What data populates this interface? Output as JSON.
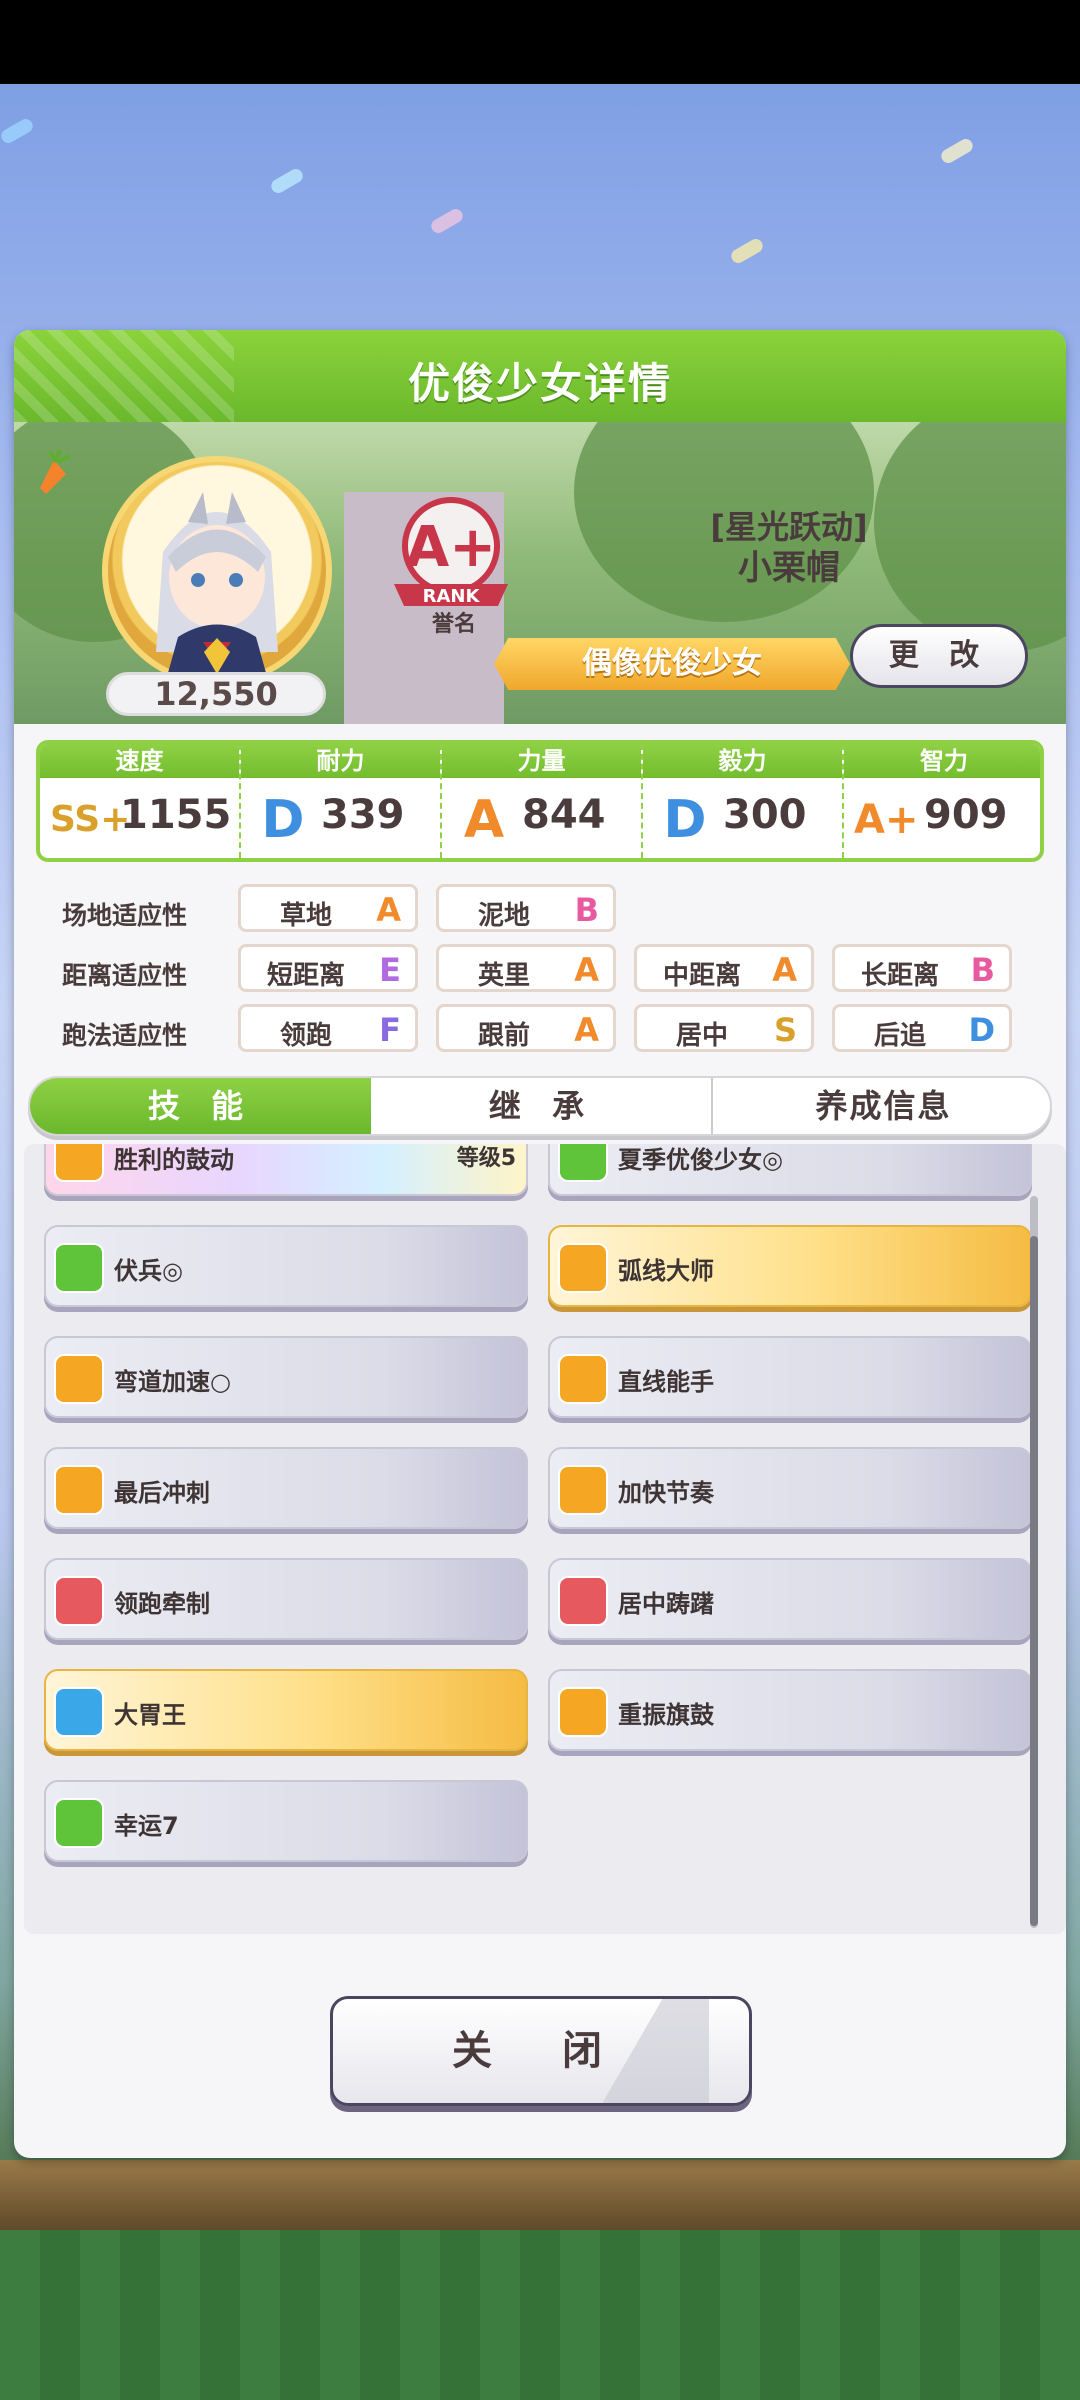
{
  "dialog": {
    "title": "优俊少女详情"
  },
  "profile": {
    "fans": "12,550",
    "rank_grade": "A+",
    "rank_word": "RANK",
    "rank_caption": "誉名",
    "epithet": "[星光跃动]",
    "name": "小栗帽",
    "style_ribbon": "偶像优俊少女",
    "change_label": "更 改"
  },
  "stats": [
    {
      "label": "速度",
      "grade": "SS+",
      "value": "1155",
      "icon": "shoe-icon",
      "color": "#d9a12b"
    },
    {
      "label": "耐力",
      "grade": "D",
      "value": "339",
      "icon": "heart-icon",
      "color": "#3f8fe0"
    },
    {
      "label": "力量",
      "grade": "A",
      "value": "844",
      "icon": "muscle-icon",
      "color": "#f08a2a"
    },
    {
      "label": "毅力",
      "grade": "D",
      "value": "300",
      "icon": "flame-icon",
      "color": "#3f8fe0"
    },
    {
      "label": "智力",
      "grade": "A+",
      "value": "909",
      "icon": "grad-cap-icon",
      "color": "#f08a2a"
    }
  ],
  "aptitudes": {
    "surface": {
      "label": "场地适应性",
      "items": [
        {
          "name": "草地",
          "grade": "A",
          "color": "#f08a2a"
        },
        {
          "name": "泥地",
          "grade": "B",
          "color": "#e85aa0"
        }
      ]
    },
    "distance": {
      "label": "距离适应性",
      "items": [
        {
          "name": "短距离",
          "grade": "E",
          "color": "#b26ae0"
        },
        {
          "name": "英里",
          "grade": "A",
          "color": "#f08a2a"
        },
        {
          "name": "中距离",
          "grade": "A",
          "color": "#f08a2a"
        },
        {
          "name": "长距离",
          "grade": "B",
          "color": "#e85aa0"
        }
      ]
    },
    "style": {
      "label": "跑法适应性",
      "items": [
        {
          "name": "领跑",
          "grade": "F",
          "color": "#8a6ae0"
        },
        {
          "name": "跟前",
          "grade": "A",
          "color": "#f08a2a"
        },
        {
          "name": "居中",
          "grade": "S",
          "color": "#d9a12b"
        },
        {
          "name": "后追",
          "grade": "D",
          "color": "#3f8fe0"
        }
      ]
    }
  },
  "tabs": [
    {
      "label": "技 能"
    },
    {
      "label": "继 承"
    },
    {
      "label": "养成信息"
    }
  ],
  "skills": [
    {
      "name": "胜利的鼓动",
      "level": "等级5",
      "style": "rainbow",
      "icon": "lion-icon",
      "icon_color": "#f5a623"
    },
    {
      "name": "夏季优俊少女◎",
      "level": "",
      "style": "plain",
      "icon": "book-icon",
      "icon_color": "#5fc43a"
    },
    {
      "name": "伏兵◎",
      "level": "",
      "style": "plain",
      "icon": "book-icon",
      "icon_color": "#5fc43a"
    },
    {
      "name": "弧线大师",
      "level": "",
      "style": "gold",
      "icon": "lion-icon",
      "icon_color": "#f5a623"
    },
    {
      "name": "弯道加速○",
      "level": "",
      "style": "plain",
      "icon": "lion-icon",
      "icon_color": "#f5a623"
    },
    {
      "name": "直线能手",
      "level": "",
      "style": "plain",
      "icon": "lion-icon",
      "icon_color": "#f5a623"
    },
    {
      "name": "最后冲刺",
      "level": "",
      "style": "plain",
      "icon": "lion-icon",
      "icon_color": "#f5a623"
    },
    {
      "name": "加快节奏",
      "level": "",
      "style": "plain",
      "icon": "lion-icon",
      "icon_color": "#f5a623"
    },
    {
      "name": "领跑牵制",
      "level": "",
      "style": "plain",
      "icon": "sparkle-icon",
      "icon_color": "#e5595f"
    },
    {
      "name": "居中踌躇",
      "level": "",
      "style": "plain",
      "icon": "horse-icon",
      "icon_color": "#e5595f"
    },
    {
      "name": "大胃王",
      "level": "",
      "style": "gold",
      "icon": "sparkle-icon",
      "icon_color": "#3aa8e8"
    },
    {
      "name": "重振旗鼓",
      "level": "",
      "style": "plain",
      "icon": "lion-icon",
      "icon_color": "#f5a623"
    },
    {
      "name": "幸运7",
      "level": "",
      "style": "plain",
      "icon": "clover-icon",
      "icon_color": "#5fc43a"
    }
  ],
  "close_label": "关 闭"
}
